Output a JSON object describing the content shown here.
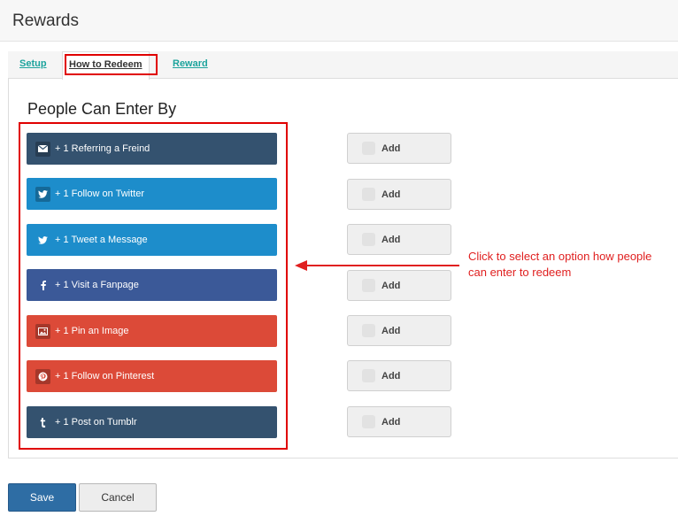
{
  "page": {
    "title": "Rewards"
  },
  "tabs": [
    {
      "label": "Setup",
      "active": false
    },
    {
      "label": "How to Redeem",
      "active": true
    },
    {
      "label": "Reward",
      "active": false
    }
  ],
  "section": {
    "heading": "People Can Enter By"
  },
  "options": [
    {
      "label": "+ 1 Referring a Freind",
      "icon": "envelope-icon",
      "color": "#34526f"
    },
    {
      "label": "+ 1 Follow on Twitter",
      "icon": "twitter-icon",
      "color": "#1d8dcb"
    },
    {
      "label": "+ 1 Tweet a Message",
      "icon": "twitter-icon",
      "color": "#1d8dcb"
    },
    {
      "label": "+ 1 Visit a Fanpage",
      "icon": "facebook-icon",
      "color": "#3b5998"
    },
    {
      "label": "+ 1 Pin an Image",
      "icon": "image-icon",
      "color": "#dc4a38"
    },
    {
      "label": "+ 1 Follow on Pinterest",
      "icon": "pinterest-icon",
      "color": "#dc4a38"
    },
    {
      "label": "+ 1 Post on Tumblr",
      "icon": "tumblr-icon",
      "color": "#34526f"
    }
  ],
  "add_label": "Add",
  "annotation": {
    "text": "Click to select an option how people can enter to redeem",
    "color": "#e02020"
  },
  "footer": {
    "save_label": "Save",
    "cancel_label": "Cancel"
  },
  "colors": {
    "highlight": "#e00000",
    "tab_link": "#1ba39c",
    "save_button": "#2e6da4"
  }
}
